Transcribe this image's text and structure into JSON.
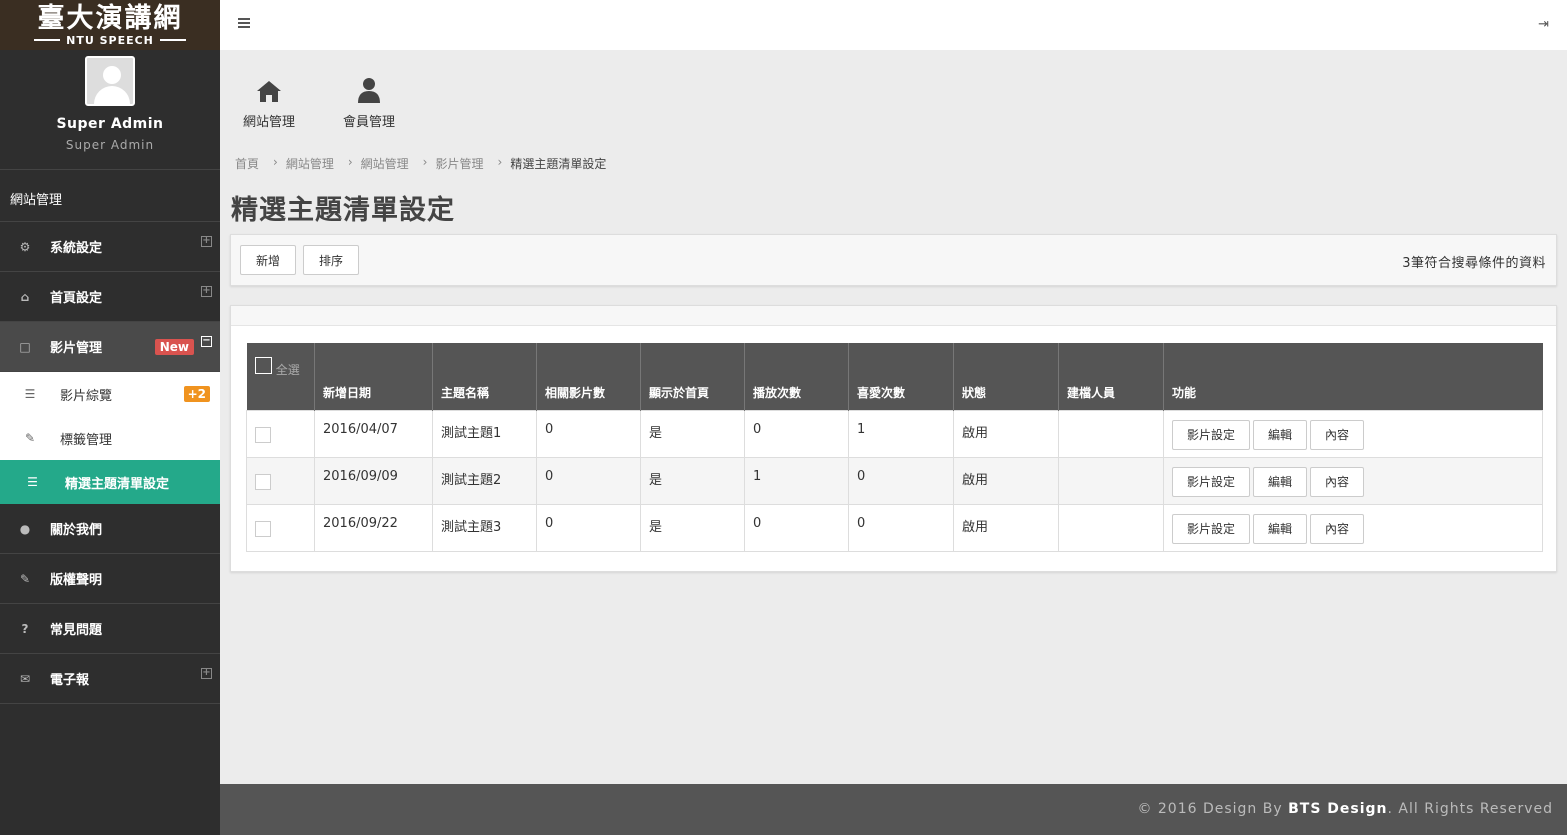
{
  "brand": {
    "main": "臺大演講網",
    "sub": "NTU SPEECH"
  },
  "profile": {
    "name": "Super Admin",
    "role": "Super Admin"
  },
  "sidebar": {
    "section_title": "網站管理",
    "items": [
      {
        "label": "系統設定",
        "icon": "gears-icon"
      },
      {
        "label": "首頁設定",
        "icon": "home-icon"
      },
      {
        "label": "影片管理",
        "icon": "square-icon",
        "badge": "New"
      },
      {
        "label": "關於我們",
        "icon": "user-icon"
      },
      {
        "label": "版權聲明",
        "icon": "edit-icon"
      },
      {
        "label": "常見問題",
        "icon": "question-icon"
      },
      {
        "label": "電子報",
        "icon": "envelope-icon"
      }
    ],
    "submenu": [
      {
        "label": "影片綜覽",
        "icon": "list-icon",
        "badge": "+2"
      },
      {
        "label": "標籤管理",
        "icon": "pencil-icon"
      },
      {
        "label": "精選主題清單設定",
        "icon": "list-icon"
      }
    ]
  },
  "quicknav": [
    {
      "label": "網站管理",
      "icon": "home-icon"
    },
    {
      "label": "會員管理",
      "icon": "user-icon"
    }
  ],
  "breadcrumb": [
    "首頁",
    "網站管理",
    "網站管理",
    "影片管理",
    "精選主題清單設定"
  ],
  "page_title": "精選主題清單設定",
  "toolbar": {
    "add_label": "新增",
    "sort_label": "排序",
    "count_text": "3筆符合搜尋條件的資料"
  },
  "table": {
    "select_all": "全選",
    "headers": [
      "新增日期",
      "主題名稱",
      "相關影片數",
      "顯示於首頁",
      "播放次數",
      "喜愛次數",
      "狀態",
      "建檔人員",
      "功能"
    ],
    "rows": [
      {
        "date": "2016/04/07",
        "name": "測試主題1",
        "videos": "0",
        "home": "是",
        "plays": "0",
        "likes": "1",
        "status": "啟用",
        "creator": ""
      },
      {
        "date": "2016/09/09",
        "name": "測試主題2",
        "videos": "0",
        "home": "是",
        "plays": "1",
        "likes": "0",
        "status": "啟用",
        "creator": ""
      },
      {
        "date": "2016/09/22",
        "name": "測試主題3",
        "videos": "0",
        "home": "是",
        "plays": "0",
        "likes": "0",
        "status": "啟用",
        "creator": ""
      }
    ],
    "actions": [
      "影片設定",
      "編輯",
      "內容"
    ]
  },
  "footer": {
    "prefix": "© 2016 Design By ",
    "brand": "BTS Design",
    "suffix": ". All Rights Reserved"
  },
  "colors": {
    "sidebar": "#2e2e2e",
    "active": "#24a98a",
    "new_badge": "#d9534f",
    "plus_badge": "#f0931f",
    "table_head": "#555555"
  }
}
